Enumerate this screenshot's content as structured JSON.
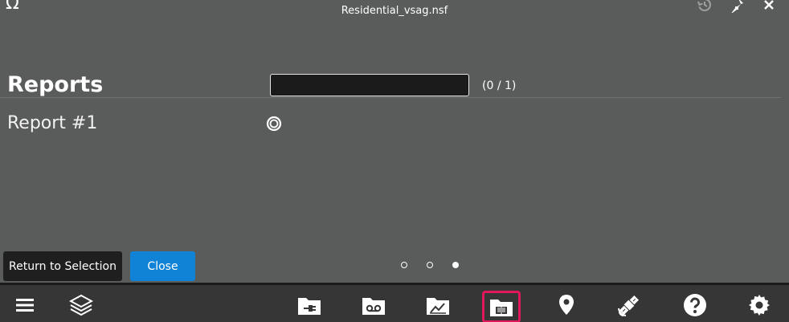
{
  "app": {
    "filename": "Residential_vsag.nsf"
  },
  "panel": {
    "title": "Reports",
    "search": {
      "value": "",
      "placeholder": ""
    },
    "count": "(0 / 1)",
    "reports": [
      {
        "label": "Report #1"
      }
    ]
  },
  "actions": {
    "return_label": "Return to Selection",
    "close_label": "Close"
  },
  "pager": {
    "pages": 3,
    "current": 3
  },
  "toolbar": {
    "items": [
      {
        "icon": "menu-icon"
      },
      {
        "icon": "layers-icon"
      },
      {
        "icon": "folder-plug-icon"
      },
      {
        "icon": "folder-voicemail-icon"
      },
      {
        "icon": "folder-chart-icon"
      },
      {
        "icon": "folder-report-icon",
        "selected": true
      },
      {
        "icon": "map-pin-icon"
      },
      {
        "icon": "satellite-icon"
      },
      {
        "icon": "help-icon"
      },
      {
        "icon": "gear-icon"
      }
    ]
  },
  "colors": {
    "background": "#5a5c5b",
    "toolbar": "#353635",
    "accent_blue": "#1183d6",
    "selection": "#e0185a"
  }
}
